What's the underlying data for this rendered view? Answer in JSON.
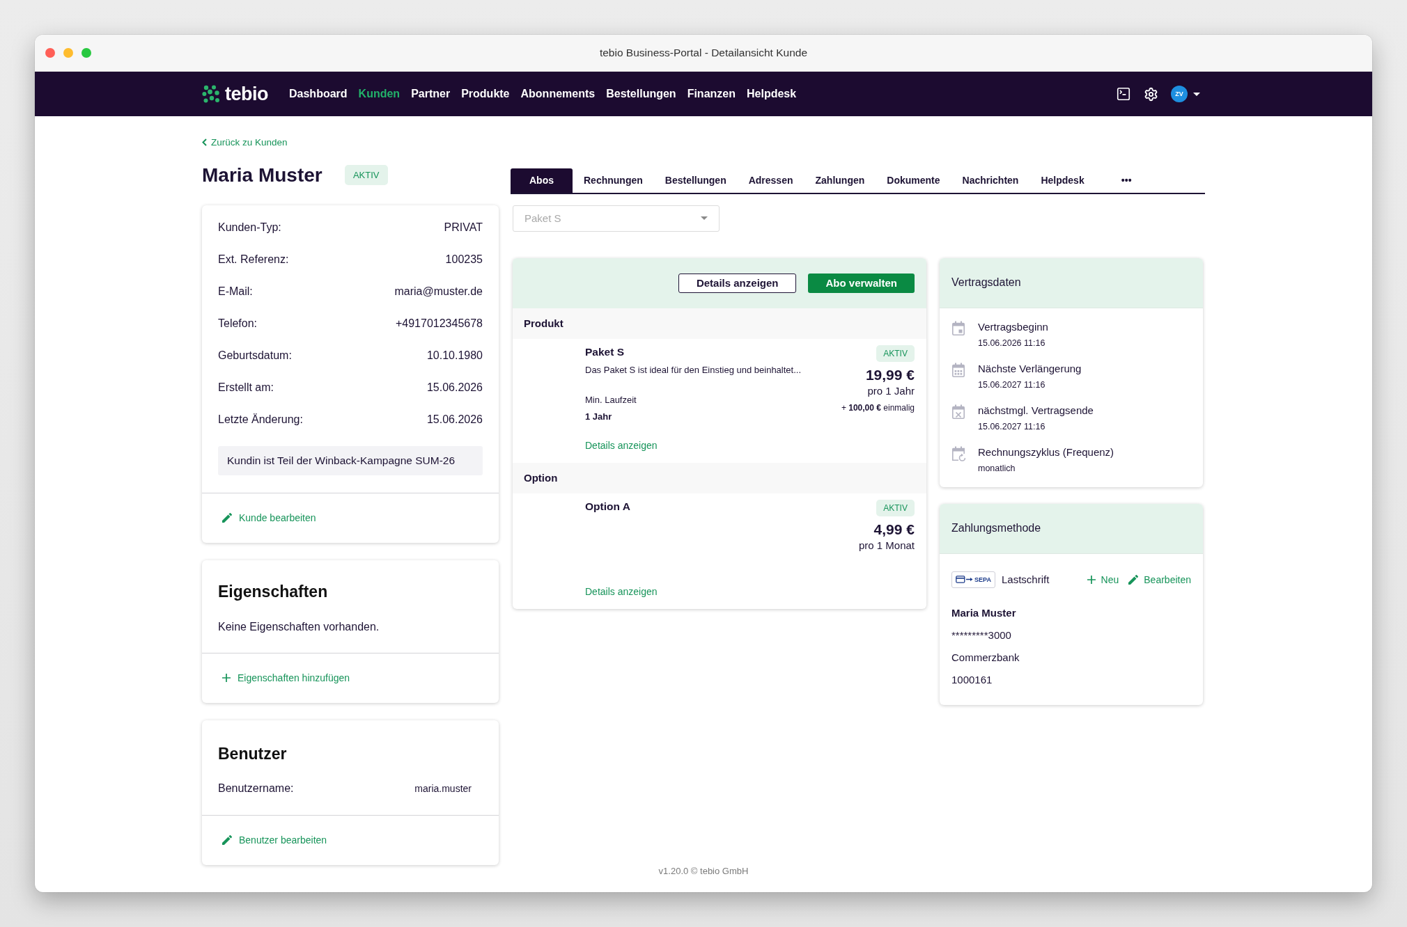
{
  "window": {
    "title": "tebio Business-Portal - Detailansicht Kunde"
  },
  "nav": {
    "logo": "tebio",
    "items": [
      {
        "label": "Dashboard",
        "selected": false
      },
      {
        "label": "Kunden",
        "selected": true
      },
      {
        "label": "Partner",
        "selected": false
      },
      {
        "label": "Produkte",
        "selected": false
      },
      {
        "label": "Abonnements",
        "selected": false
      },
      {
        "label": "Bestellungen",
        "selected": false
      },
      {
        "label": "Finanzen",
        "selected": false
      },
      {
        "label": "Helpdesk",
        "selected": false
      }
    ],
    "avatar": "ZV"
  },
  "back_link": "Zurück zu Kunden",
  "customer": {
    "name": "Maria Muster",
    "status": "AKTIV"
  },
  "details_card": {
    "fields": [
      {
        "label": "Kunden-Typ:",
        "value": "PRIVAT"
      },
      {
        "label": "Ext. Referenz:",
        "value": "100235"
      },
      {
        "label": "E-Mail:",
        "value": "maria@muster.de"
      },
      {
        "label": "Telefon:",
        "value": "+4917012345678"
      },
      {
        "label": "Geburtsdatum:",
        "value": "10.10.1980"
      },
      {
        "label": "Erstellt am:",
        "value": "15.06.2026"
      },
      {
        "label": "Letzte Änderung:",
        "value": "15.06.2026"
      }
    ],
    "note": "Kundin ist Teil der Winback-Kampagne SUM-26",
    "action": {
      "kind": "edit",
      "label": "Kunde bearbeiten"
    }
  },
  "properties_card": {
    "title": "Eigenschaften",
    "empty_text": "Keine Eigenschaften vorhanden.",
    "action": {
      "kind": "add",
      "label": "Eigenschaften hinzufügen"
    }
  },
  "user_card": {
    "title": "Benutzer",
    "fields": [
      {
        "label": "Benutzername:",
        "value": "maria.muster"
      }
    ],
    "action": {
      "kind": "edit",
      "label": "Benutzer bearbeiten"
    }
  },
  "tabs": [
    {
      "label": "Abos",
      "selected": true
    },
    {
      "label": "Rechnungen",
      "selected": false
    },
    {
      "label": "Bestellungen",
      "selected": false
    },
    {
      "label": "Adressen",
      "selected": false
    },
    {
      "label": "Zahlungen",
      "selected": false
    },
    {
      "label": "Dokumente",
      "selected": false
    },
    {
      "label": "Nachrichten",
      "selected": false
    },
    {
      "label": "Helpdesk",
      "selected": false
    },
    {
      "label": "•••",
      "selected": false
    }
  ],
  "subscription_select": {
    "placeholder": "Paket S"
  },
  "subscription_card": {
    "buttons": [
      {
        "kind": "outline",
        "label": "Details anzeigen"
      },
      {
        "kind": "primary",
        "label": "Abo verwalten"
      }
    ],
    "sections": [
      {
        "title": "Produkt",
        "items": [
          {
            "name": "Paket S",
            "description": "Das Paket S ist ideal für den Einstieg und beinhaltet...",
            "min_term_label": "Min. Laufzeit",
            "min_term": "1 Jahr",
            "link": "Details anzeigen",
            "status": "AKTIV",
            "price": "19,99 €",
            "period": "pro 1 Jahr",
            "one_time": "+ **100,00 €** einmalig"
          }
        ]
      },
      {
        "title": "Option",
        "items": [
          {
            "name": "Option A",
            "link": "Details anzeigen",
            "status": "AKTIV",
            "price": "4,99 €",
            "period": "pro 1 Monat"
          }
        ]
      }
    ]
  },
  "contract_card": {
    "title": "Vertragsdaten",
    "items": [
      {
        "kind": "start",
        "label": "Vertragsbeginn",
        "value": "15.06.2026 11:16"
      },
      {
        "kind": "renewal",
        "label": "Nächste Verlängerung",
        "value": "15.06.2027 11:16"
      },
      {
        "kind": "end",
        "label": "nächstmgl. Vertragsende",
        "value": "15.06.2027 11:16"
      },
      {
        "kind": "cycle",
        "label": "Rechnungszyklus (Frequenz)",
        "value": "monatlich"
      }
    ]
  },
  "payment_card": {
    "title": "Zahlungsmethode",
    "badge": "SEPA",
    "method": "Lastschrift",
    "actions": [
      {
        "kind": "add",
        "label": "Neu"
      },
      {
        "kind": "edit",
        "label": "Bearbeiten"
      }
    ],
    "holder": "Maria Muster",
    "lines": [
      "*********3000",
      "Commerzbank",
      "1000161"
    ]
  },
  "footer": "v1.20.0 © tebio GmbH"
}
